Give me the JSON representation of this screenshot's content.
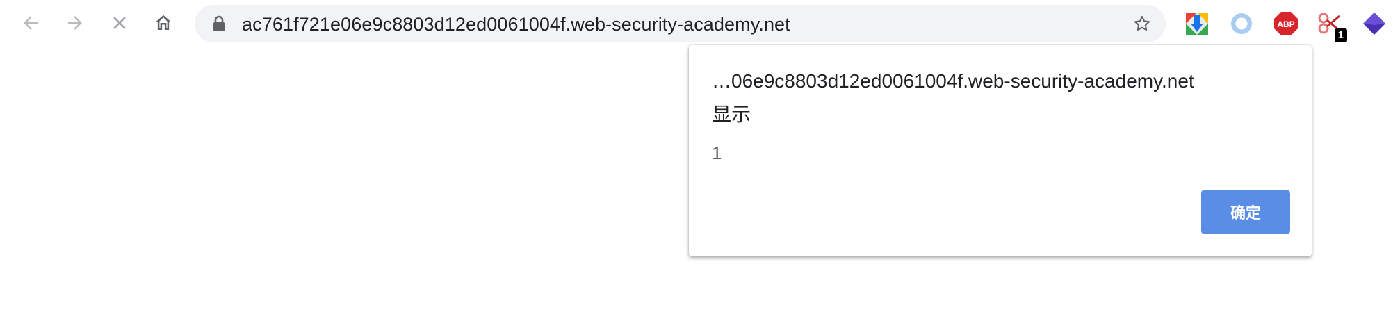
{
  "browser": {
    "address_bar": {
      "url": "ac761f721e06e9c8803d12ed0061004f.web-security-academy.net"
    },
    "navigation": {
      "back_icon": "arrow-left",
      "forward_icon": "arrow-right",
      "stop_icon": "close-x",
      "home_icon": "house"
    },
    "extensions": [
      {
        "name": "google-drive-download-icon"
      },
      {
        "name": "circle-extension-icon"
      },
      {
        "name": "adblock-plus-icon",
        "label": "ABP"
      },
      {
        "name": "scissors-extension-icon",
        "badge": "1"
      },
      {
        "name": "diamond-extension-icon"
      }
    ]
  },
  "dialog": {
    "origin": "…06e9c8803d12ed0061004f.web-security-academy.net",
    "title": "显示",
    "message": "1",
    "ok_label": "确定"
  },
  "colors": {
    "ok_button": "#5a8ee6",
    "omnibox_bg": "#f1f3f4",
    "abp_red": "#d7252b",
    "diamond_purple": "#4b2fb3"
  }
}
